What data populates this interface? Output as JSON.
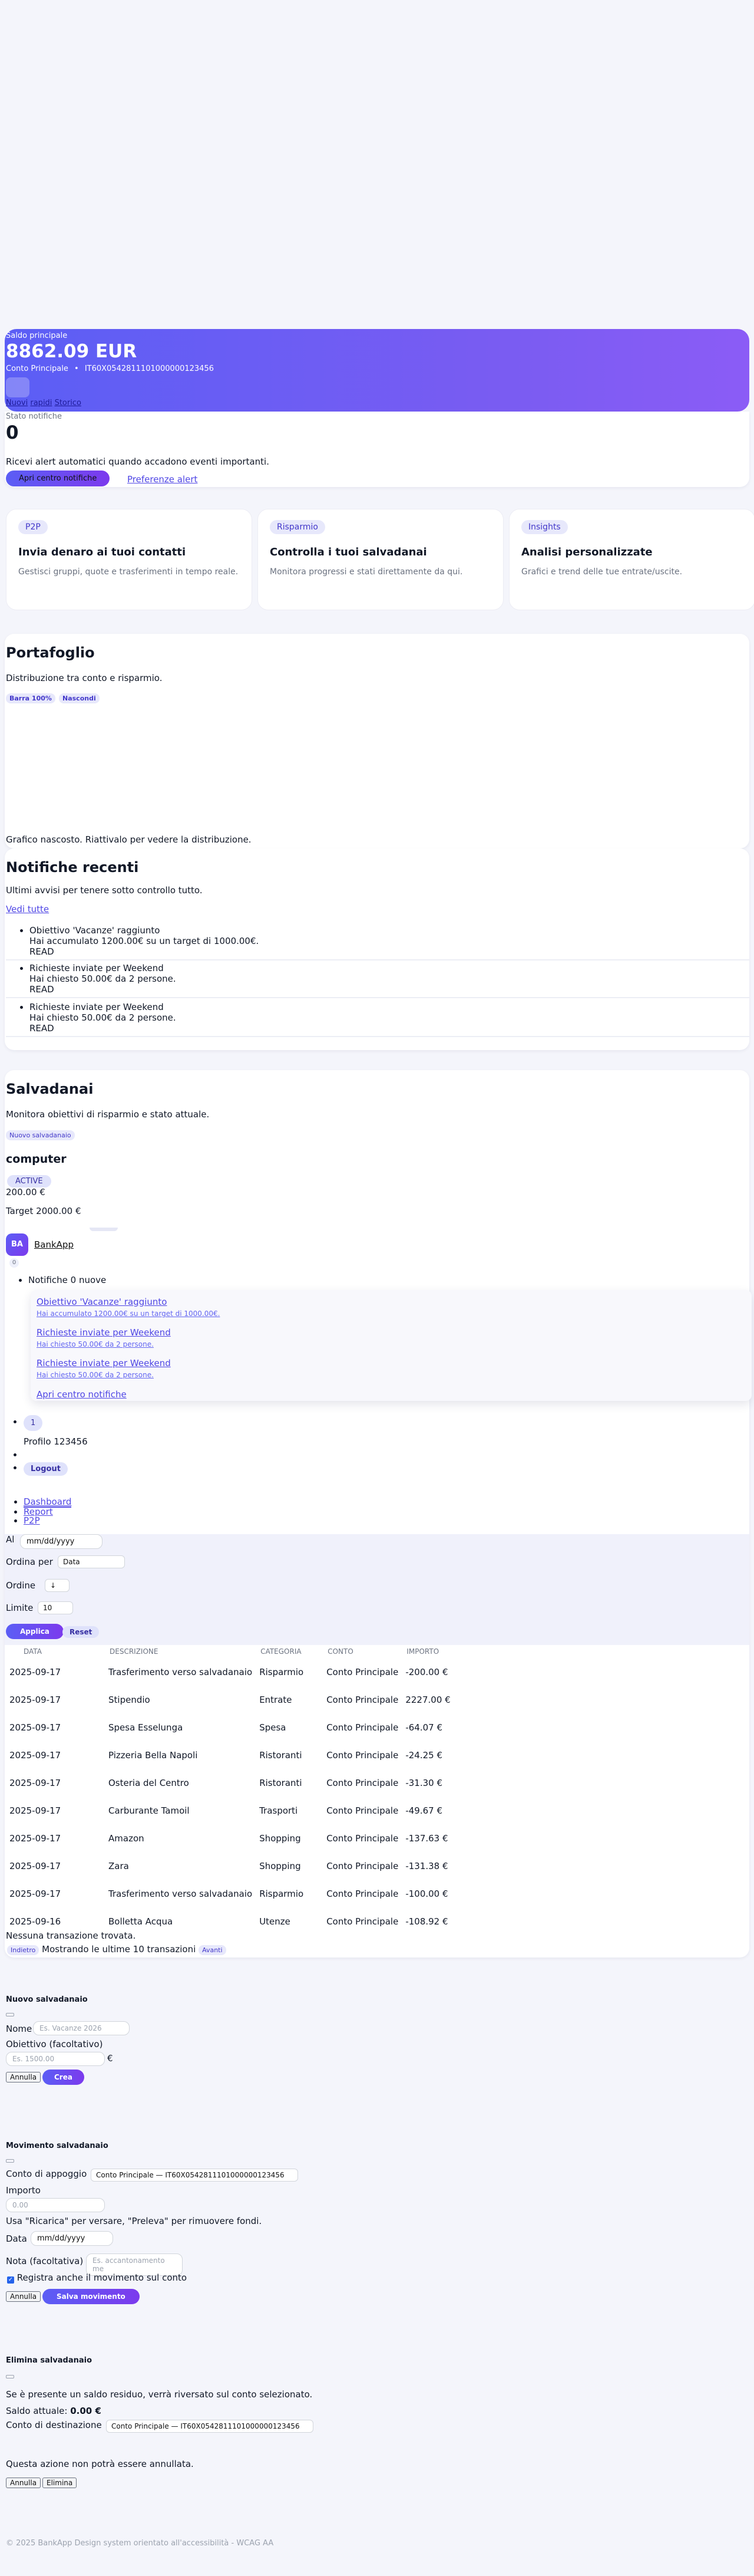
{
  "hero": {
    "label": "Saldo principale",
    "balance": "8862.09 EUR",
    "account_name": "Conto Principale",
    "separator": "•",
    "iban": "IT60X0542811101000000123456",
    "links": [
      "Nuovi",
      "rapidi",
      "Storico"
    ]
  },
  "notif_status": {
    "label": "Stato notifiche",
    "count": "0",
    "description": "Ricevi alert automatici quando accadono eventi importanti.",
    "open_center": "Apri centro notifiche",
    "preferences": "Preferenze alert"
  },
  "features": [
    {
      "chip": "P2P",
      "title": "Invia denaro ai tuoi contatti",
      "text": "Gestisci gruppi, quote e trasferimenti in tempo reale."
    },
    {
      "chip": "Risparmio",
      "title": "Controlla i tuoi salvadanai",
      "text": "Monitora progressi e stati direttamente da qui."
    },
    {
      "chip": "Insights",
      "title": "Analisi personalizzate",
      "text": "Grafici e trend delle tue entrate/uscite."
    }
  ],
  "portfolio": {
    "title": "Portafoglio",
    "subtitle": "Distribuzione tra conto e risparmio.",
    "bar_button": "Barra 100%",
    "hide_button": "Nascondi",
    "hidden_text": "Grafico nascosto. Riattivalo per vedere la distribuzione."
  },
  "recent": {
    "title": "Notifiche recenti",
    "subtitle": "Ultimi avvisi per tenere sotto controllo tutto.",
    "see_all": "Vedi tutte",
    "items": [
      {
        "title": "Obiettivo 'Vacanze' raggiunto",
        "body": "Hai accumulato 1200.00€ su un target di 1000.00€.",
        "status": "READ"
      },
      {
        "title": "Richieste inviate per Weekend",
        "body": "Hai chiesto 50.00€ da 2 persone.",
        "status": "READ"
      },
      {
        "title": "Richieste inviate per Weekend",
        "body": "Hai chiesto 50.00€ da 2 persone.",
        "status": "READ"
      }
    ]
  },
  "savings": {
    "title": "Salvadanai",
    "subtitle": "Monitora obiettivi di risparmio e stato attuale.",
    "new_button": "Nuovo salvadanaio",
    "item": {
      "name": "computer",
      "status": "ACTIVE",
      "amount": "200.00 €",
      "target": "Target 2000.00 €"
    }
  },
  "app": {
    "logo_initials": "BA",
    "name": "BankApp",
    "dropdown": {
      "badge": "0",
      "count_text": "Notifiche 0 nuove",
      "items": [
        {
          "title": "Obiettivo 'Vacanze' raggiunto",
          "body": "Hai accumulato 1200.00€ su un target di 1000.00€."
        },
        {
          "title": "Richieste inviate per Weekend",
          "body": "Hai chiesto 50.00€ da 2 persone."
        },
        {
          "title": "Richieste inviate per Weekend",
          "body": "Hai chiesto 50.00€ da 2 persone."
        }
      ],
      "open_center": "Apri centro notifiche"
    },
    "avatar_digit": "1",
    "profile": "Profilo 123456",
    "logout": "Logout",
    "nav": [
      "Dashboard",
      "Report",
      "P2P"
    ]
  },
  "filters": {
    "al_label": "Al",
    "date_placeholder": "mm/dd/yyyy",
    "order_by_label": "Ordina per",
    "order_by_value": "Data",
    "order_label": "Ordine",
    "order_value": "↓",
    "limit_label": "Limite",
    "limit_value": "10",
    "apply": "Applica",
    "reset": "Reset"
  },
  "transactions": {
    "columns": [
      "DATA",
      "DESCRIZIONE",
      "CATEGORIA",
      "CONTO",
      "IMPORTO"
    ],
    "rows": [
      [
        "2025-09-17",
        "Trasferimento verso salvadanaio",
        "Risparmio",
        "Conto Principale",
        "-200.00 €"
      ],
      [
        "2025-09-17",
        "Stipendio",
        "Entrate",
        "Conto Principale",
        "2227.00 €"
      ],
      [
        "2025-09-17",
        "Spesa Esselunga",
        "Spesa",
        "Conto Principale",
        "-64.07 €"
      ],
      [
        "2025-09-17",
        "Pizzeria Bella Napoli",
        "Ristoranti",
        "Conto Principale",
        "-24.25 €"
      ],
      [
        "2025-09-17",
        "Osteria del Centro",
        "Ristoranti",
        "Conto Principale",
        "-31.30 €"
      ],
      [
        "2025-09-17",
        "Carburante Tamoil",
        "Trasporti",
        "Conto Principale",
        "-49.67 €"
      ],
      [
        "2025-09-17",
        "Amazon",
        "Shopping",
        "Conto Principale",
        "-137.63 €"
      ],
      [
        "2025-09-17",
        "Zara",
        "Shopping",
        "Conto Principale",
        "-131.38 €"
      ],
      [
        "2025-09-17",
        "Trasferimento verso salvadanaio",
        "Risparmio",
        "Conto Principale",
        "-100.00 €"
      ],
      [
        "2025-09-16",
        "Bolletta Acqua",
        "Utenze",
        "Conto Principale",
        "-108.92 €"
      ]
    ],
    "empty": "Nessuna transazione trovata.",
    "prev": "Indietro",
    "showing": "Mostrando le ultime 10 transazioni",
    "next": "Avanti"
  },
  "new_jar": {
    "title": "Nuovo salvadanaio",
    "name_label": "Nome",
    "name_placeholder": "Es. Vacanze 2026",
    "goal_label": "Obiettivo (facoltativo)",
    "goal_placeholder": "Es. 1500.00",
    "currency": "€",
    "cancel": "Annulla",
    "create": "Crea"
  },
  "movement": {
    "title": "Movimento salvadanaio",
    "account_label": "Conto di appoggio",
    "account_value": "Conto Principale — IT60X0542811101000000123456",
    "amount_label": "Importo",
    "amount_placeholder": "0.00",
    "hint": "Usa \"Ricarica\" per versare, \"Preleva\" per rimuovere fondi.",
    "date_label": "Data",
    "date_placeholder": "mm/dd/yyyy",
    "note_label": "Nota (facoltativa)",
    "note_placeholder": "Es. accantonamento me",
    "register_label": "Registra anche il movimento sul conto",
    "cancel": "Annulla",
    "save": "Salva movimento"
  },
  "delete_jar": {
    "title": "Elimina salvadanaio",
    "warning": "Se è presente un saldo residuo, verrà riversato sul conto selezionato.",
    "balance_label": "Saldo attuale:",
    "balance_value": "0.00 €",
    "dest_label": "Conto di destinazione",
    "dest_value": "Conto Principale — IT60X0542811101000000123456",
    "irreversible": "Questa azione non potrà essere annullata.",
    "cancel": "Annulla",
    "delete": "Elimina"
  },
  "footer": "© 2025 BankApp Design system orientato all'accessibilità - WCAG AA"
}
